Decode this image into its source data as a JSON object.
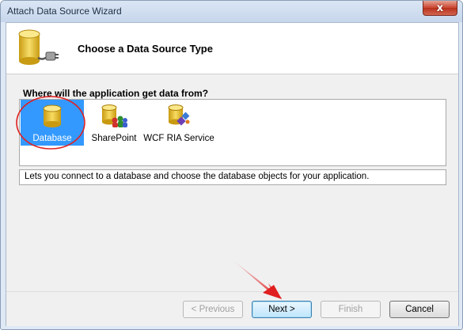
{
  "window": {
    "title": "Attach Data Source Wizard",
    "close_glyph": "x"
  },
  "header": {
    "title": "Choose a Data Source Type",
    "icon": "database-plug-icon"
  },
  "question": "Where will the application get data from?",
  "sources": [
    {
      "label": "Database",
      "icon": "database-icon",
      "selected": true
    },
    {
      "label": "SharePoint",
      "icon": "sharepoint-icon",
      "selected": false
    },
    {
      "label": "WCF RIA Service",
      "icon": "wcf-ria-service-icon",
      "selected": false
    }
  ],
  "description": "Lets you connect to a database and choose the database objects for your application.",
  "buttons": {
    "previous": "< Previous",
    "next": "Next >",
    "finish": "Finish",
    "cancel": "Cancel"
  },
  "colors": {
    "selection": "#3399ff",
    "annotation": "#e02020"
  }
}
